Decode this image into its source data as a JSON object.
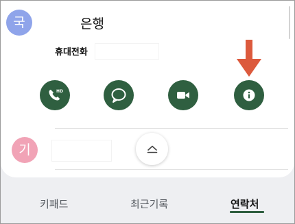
{
  "contact": {
    "initial": "국",
    "name": "은행",
    "phone_label": "휴대전화"
  },
  "actions": {
    "call": "call-hd-icon",
    "message": "message-icon",
    "video": "video-call-icon",
    "info": "info-icon"
  },
  "annotation": {
    "arrow_color": "#dc5a3d",
    "points_to": "info-icon"
  },
  "next_contact": {
    "initial": "기"
  },
  "fab": {
    "icon": "chevron-up-icon"
  },
  "tabs": {
    "keypad": "키패드",
    "recents": "최근기록",
    "contacts": "연락처",
    "active": "연락처"
  },
  "colors": {
    "accent_green": "#2f5f40",
    "avatar_blue": "#8fa4ea",
    "avatar_pink": "#f1a3b6"
  }
}
